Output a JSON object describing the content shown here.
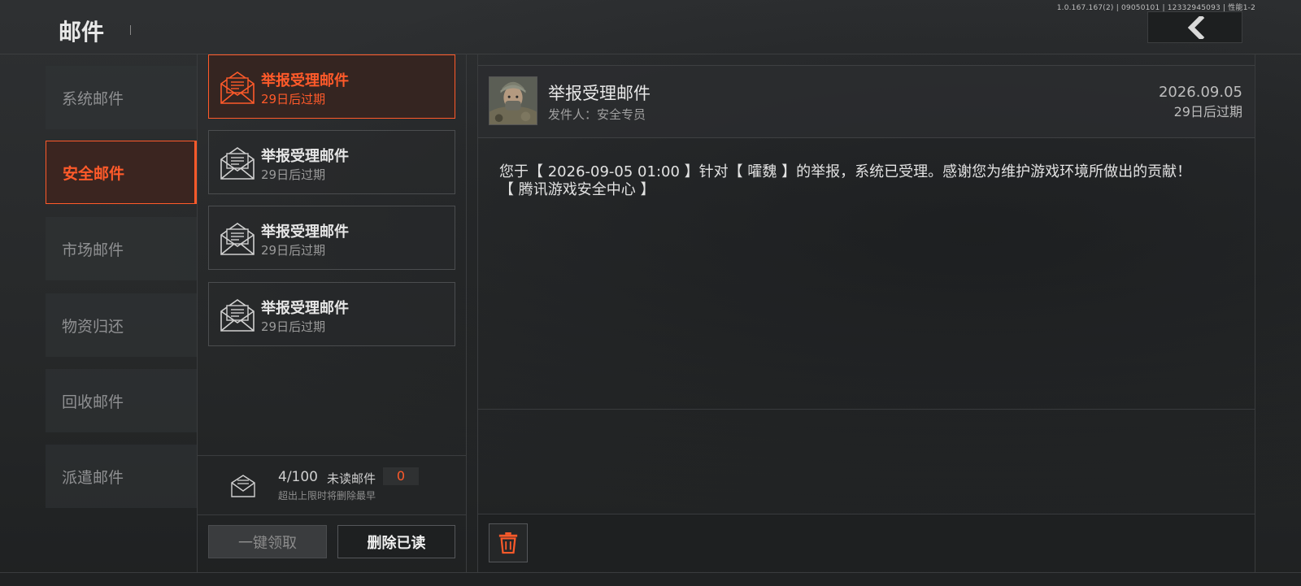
{
  "version_info": "1.0.167.167(2) | 09050101 | 12332945093 | 性能1-2",
  "header": {
    "title": "邮件"
  },
  "categories": [
    {
      "label": "系统邮件"
    },
    {
      "label": "安全邮件"
    },
    {
      "label": "市场邮件"
    },
    {
      "label": "物资归还"
    },
    {
      "label": "回收邮件"
    },
    {
      "label": "派遣邮件"
    }
  ],
  "mail_list": [
    {
      "title": "举报受理邮件",
      "expire": "29日后过期"
    },
    {
      "title": "举报受理邮件",
      "expire": "29日后过期"
    },
    {
      "title": "举报受理邮件",
      "expire": "29日后过期"
    },
    {
      "title": "举报受理邮件",
      "expire": "29日后过期"
    }
  ],
  "stats": {
    "count": "4/100",
    "unread_label": "未读邮件",
    "unread_count": "0",
    "hint": "超出上限时将删除最早"
  },
  "buttons": {
    "claim_all": "一键领取",
    "delete_read": "删除已读"
  },
  "detail": {
    "title": "举报受理邮件",
    "sender": "发件人：安全专员",
    "date": "2026.09.05",
    "expire": "29日后过期",
    "body_line1": "您于【 2026-09-05 01:00 】针对【 嚯魏 】的举报，系统已受理。感谢您为维护游戏环境所做出的贡献！",
    "body_line2": "【 腾讯游戏安全中心 】"
  },
  "colors": {
    "accent": "#ff5a2a",
    "background": "#2a2c2e"
  }
}
